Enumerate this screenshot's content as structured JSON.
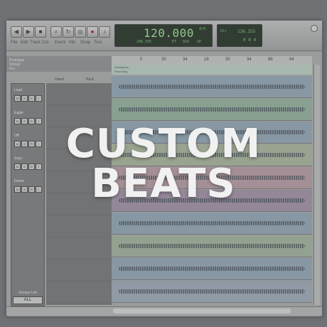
{
  "toolbar": {
    "menu": [
      "File",
      "Edit",
      "Track",
      "Cut",
      "Event",
      "Mix",
      "Snap",
      "Tool"
    ],
    "buttons": [
      "rewind",
      "play",
      "stop",
      "record",
      "loop",
      "cycle",
      "metronome",
      "tuner"
    ]
  },
  "lcd_main": {
    "tempo": "120.000",
    "sig": "4/4",
    "sub": "ET",
    "sub2": "SP",
    "pos": "290.335",
    "val": "010",
    "val2": "00.00"
  },
  "lcd_side": {
    "top": "136.255",
    "bot": "0 0 4",
    "label": "Gtr"
  },
  "tracks_header": [
    "Prototype",
    "Strings",
    "Fx+"
  ],
  "columns": {
    "direct": "Direct",
    "pack": "Pack"
  },
  "inspector_channels": [
    {
      "name": "Lead",
      "buttons": [
        "M",
        "S",
        "R",
        "I"
      ]
    },
    {
      "name": "Eagle",
      "buttons": [
        "M",
        "S",
        "R",
        "I"
      ]
    },
    {
      "name": "Off",
      "buttons": [
        "M",
        "S",
        "R",
        "I"
      ]
    },
    {
      "name": "Says",
      "buttons": [
        "M",
        "S",
        "R",
        "I"
      ]
    },
    {
      "name": "Desire",
      "buttons": [
        "M",
        "S",
        "R",
        "I"
      ]
    }
  ],
  "group": {
    "label": "Groups Lim",
    "button": "ALL"
  },
  "ruler_marks": [
    "0",
    "30",
    "34",
    "18",
    "30",
    "34",
    "86",
    "84"
  ],
  "marker_lines": [
    "Guitarphon",
    "Recording"
  ],
  "lane_colors": [
    "#8fa6b5",
    "#90b09a",
    "#8fa6b5",
    "#a9b59a",
    "#b49aa0",
    "#9f8fa5",
    "#8fa6b5",
    "#9fb29a",
    "#8fa6b5",
    "#9aa9b5"
  ],
  "headline": {
    "line1": "CUSTOM",
    "line2": "BEATS"
  }
}
